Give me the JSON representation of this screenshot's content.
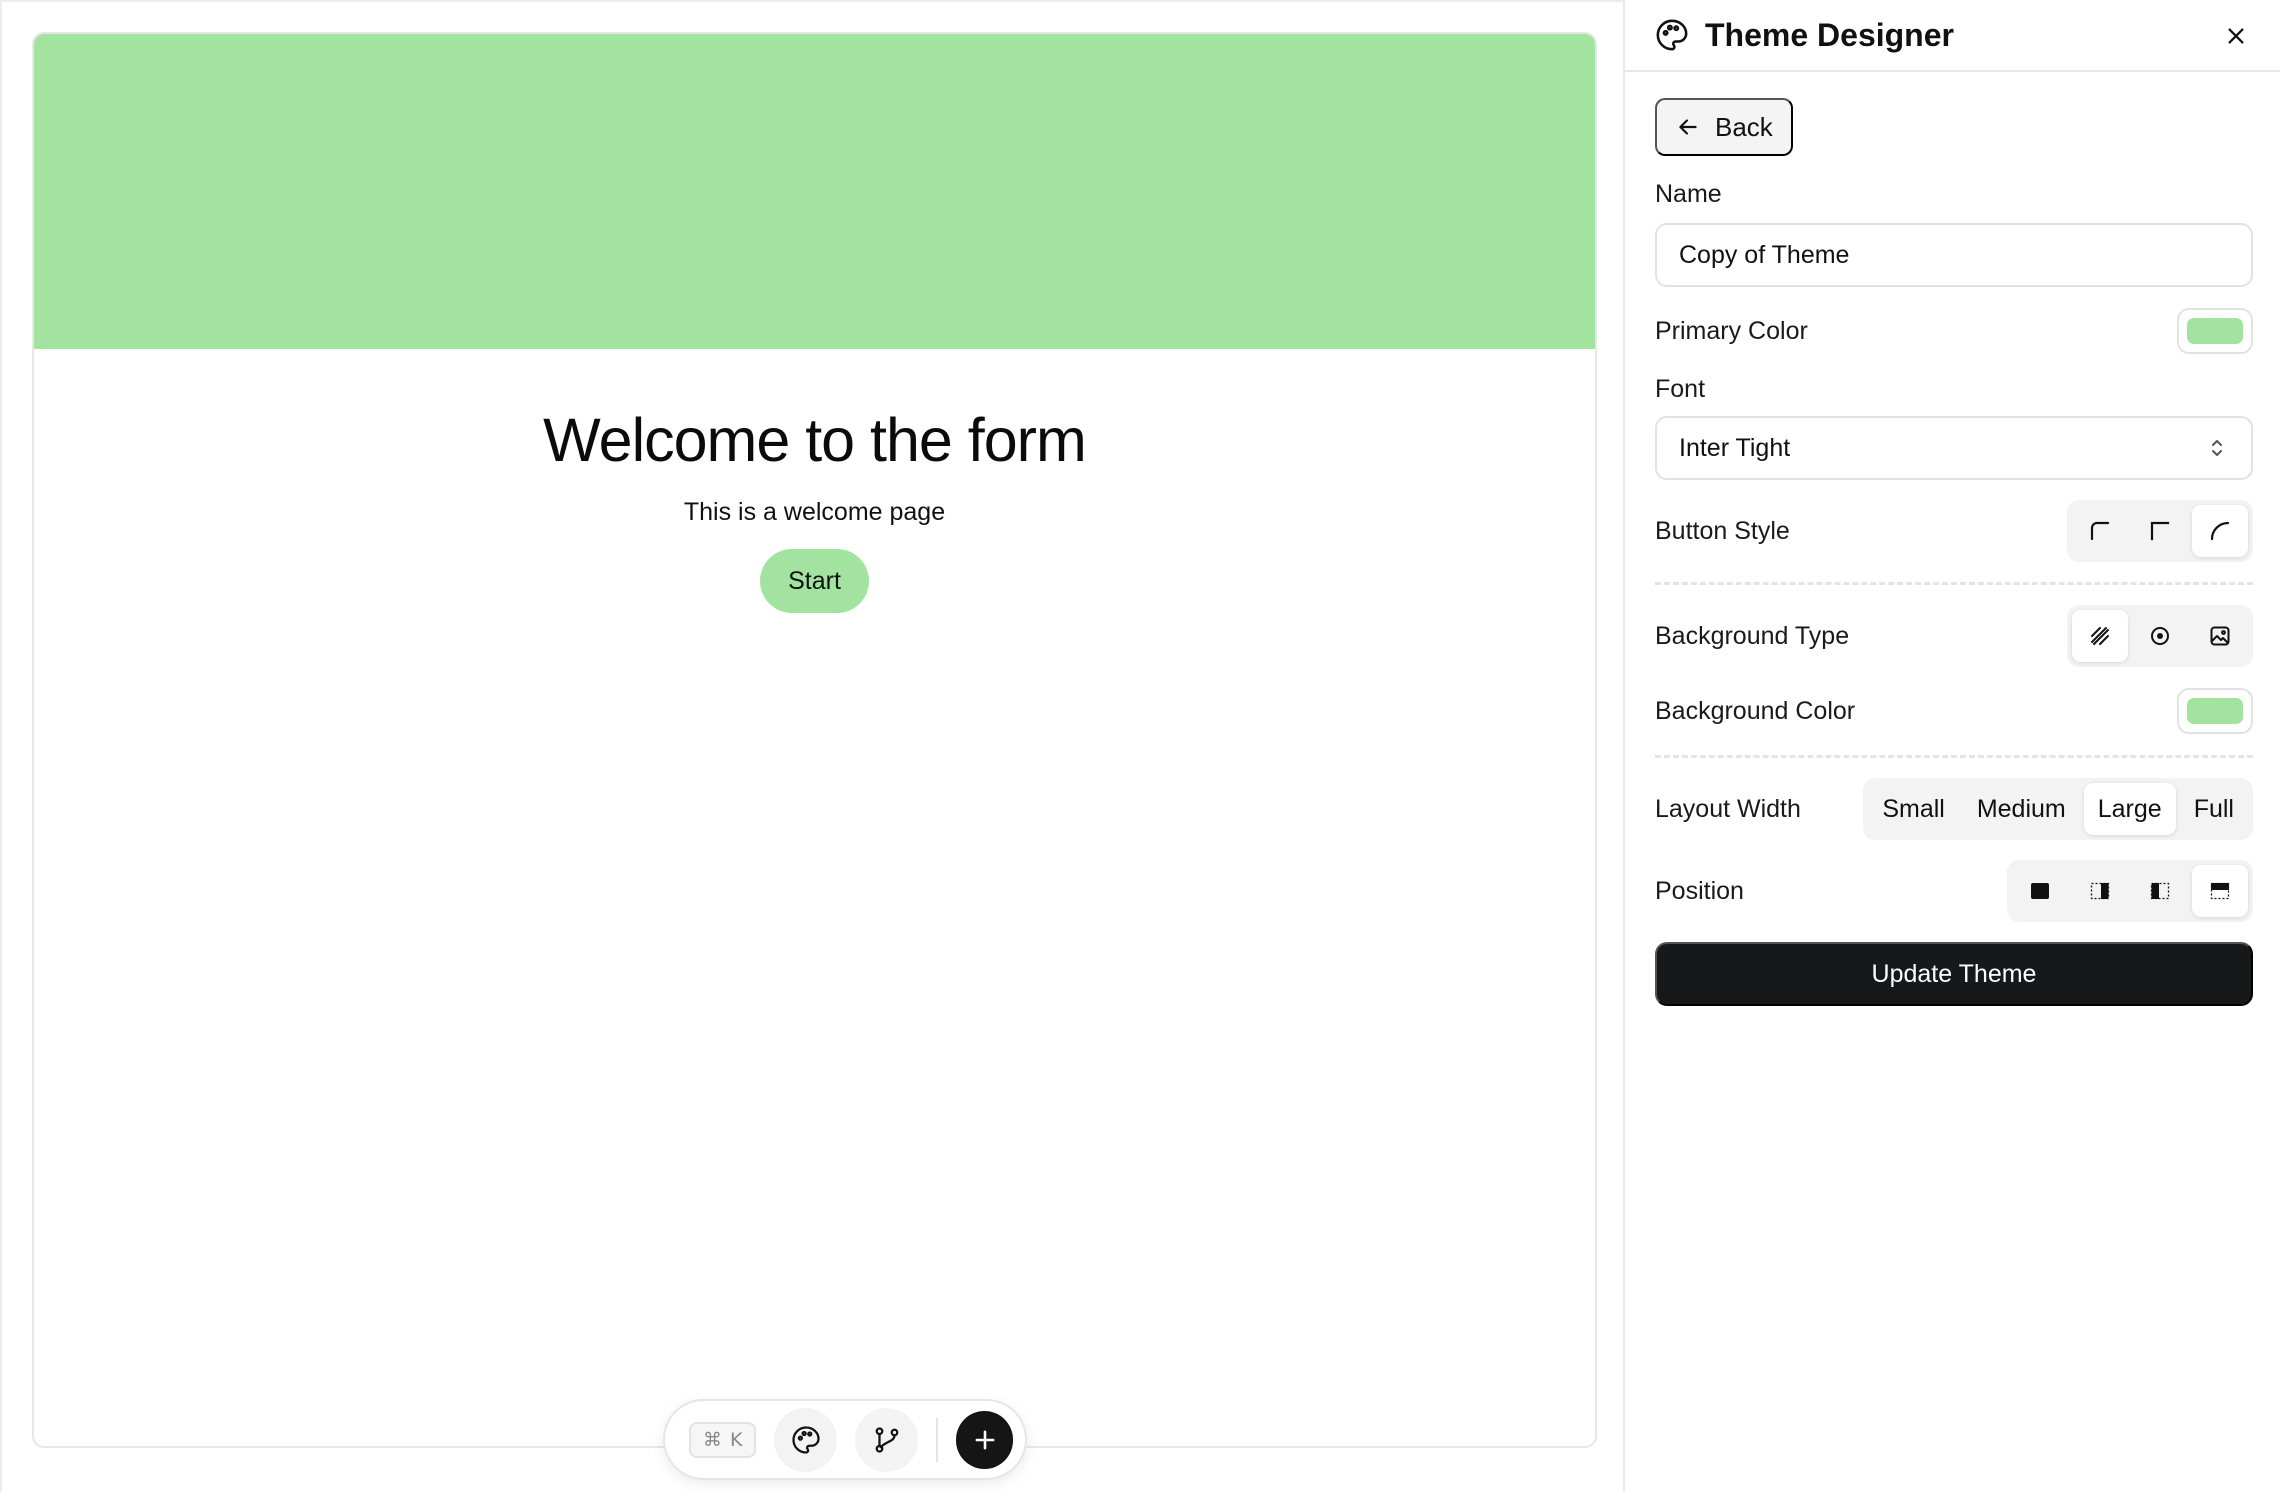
{
  "colors": {
    "primary": "#a3e3a0",
    "background": "#a3e3a0",
    "accent_dark": "#17181a"
  },
  "preview": {
    "title": "Welcome to the form",
    "subtitle": "This is a welcome page",
    "start_label": "Start"
  },
  "toolbar": {
    "shortcut_symbol": "⌘",
    "shortcut_key": "K",
    "icons": [
      "palette-icon",
      "git-branch-icon",
      "plus-icon"
    ]
  },
  "panel": {
    "title": "Theme Designer",
    "back_label": "Back",
    "name_label": "Name",
    "name_value": "Copy of Theme",
    "primary_color_label": "Primary Color",
    "font_label": "Font",
    "font_value": "Inter Tight",
    "button_style_label": "Button Style",
    "button_style_options": [
      "rounded-small",
      "square",
      "rounded-large"
    ],
    "button_style_selected": "rounded-large",
    "background_type_label": "Background Type",
    "background_type_options": [
      "solid",
      "gradient",
      "image"
    ],
    "background_type_selected": "solid",
    "background_color_label": "Background Color",
    "layout_width_label": "Layout Width",
    "layout_width_options": [
      "Small",
      "Medium",
      "Large",
      "Full"
    ],
    "layout_width_selected": "Large",
    "position_label": "Position",
    "position_options": [
      "full",
      "right",
      "left",
      "top"
    ],
    "position_selected": "top",
    "update_label": "Update Theme"
  }
}
